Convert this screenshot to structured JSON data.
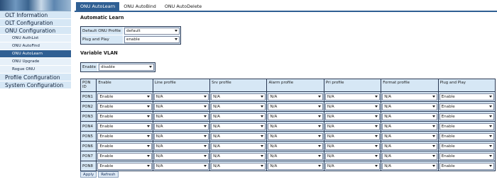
{
  "sidebar": {
    "items": [
      {
        "label": "OLT Information",
        "level": 0,
        "active": false
      },
      {
        "label": "OLT Configuration",
        "level": 0,
        "active": false
      },
      {
        "label": "ONU Configuration",
        "level": 0,
        "active": false
      },
      {
        "label": "ONU AuthList",
        "level": 1,
        "active": false
      },
      {
        "label": "ONU AutoFind",
        "level": 1,
        "active": false
      },
      {
        "label": "ONU AutoLearn",
        "level": 1,
        "active": true
      },
      {
        "label": "ONU Upgrade",
        "level": 1,
        "active": false
      },
      {
        "label": "Rogue ONU",
        "level": 1,
        "active": false
      },
      {
        "label": "Profile Configuration",
        "level": 0,
        "active": false
      },
      {
        "label": "System Configuration",
        "level": 0,
        "active": false
      }
    ]
  },
  "tabs": [
    {
      "label": "ONU AutoLearn",
      "active": true
    },
    {
      "label": "ONU AutoBind",
      "active": false
    },
    {
      "label": "ONU AutoDelete",
      "active": false
    }
  ],
  "auto_learn": {
    "title": "Automatic Learn",
    "default_profile_label": "Default ONU Profile",
    "default_profile_value": "default",
    "plug_play_label": "Plug and Play",
    "plug_play_value": "enable"
  },
  "variable_vlan": {
    "title": "Variable VLAN",
    "enable_label": "Enable",
    "enable_value": "disable"
  },
  "table": {
    "headers": [
      "PON ID",
      "Enable",
      "Line profile",
      "Srv profile",
      "Alarm profile",
      "Pri profile",
      "Format profile",
      "Plug and Play"
    ],
    "rows": [
      {
        "pon": "PON1",
        "cells": [
          "Enable",
          "N/A",
          "N/A",
          "N/A",
          "N/A",
          "N/A",
          "Enable"
        ]
      },
      {
        "pon": "PON2",
        "cells": [
          "Enable",
          "N/A",
          "N/A",
          "N/A",
          "N/A",
          "N/A",
          "Enable"
        ]
      },
      {
        "pon": "PON3",
        "cells": [
          "Enable",
          "N/A",
          "N/A",
          "N/A",
          "N/A",
          "N/A",
          "Enable"
        ]
      },
      {
        "pon": "PON4",
        "cells": [
          "Enable",
          "N/A",
          "N/A",
          "N/A",
          "N/A",
          "N/A",
          "Enable"
        ]
      },
      {
        "pon": "PON5",
        "cells": [
          "Enable",
          "N/A",
          "N/A",
          "N/A",
          "N/A",
          "N/A",
          "Enable"
        ]
      },
      {
        "pon": "PON6",
        "cells": [
          "Enable",
          "N/A",
          "N/A",
          "N/A",
          "N/A",
          "N/A",
          "Enable"
        ]
      },
      {
        "pon": "PON7",
        "cells": [
          "Enable",
          "N/A",
          "N/A",
          "N/A",
          "N/A",
          "N/A",
          "Enable"
        ]
      },
      {
        "pon": "PON8",
        "cells": [
          "Enable",
          "N/A",
          "N/A",
          "N/A",
          "N/A",
          "N/A",
          "Enable"
        ]
      }
    ]
  },
  "buttons": {
    "apply": "Apply",
    "refresh": "Refresh"
  },
  "colors": {
    "accent": "#2f5f93",
    "cell_bg": "#d6e7f5"
  }
}
